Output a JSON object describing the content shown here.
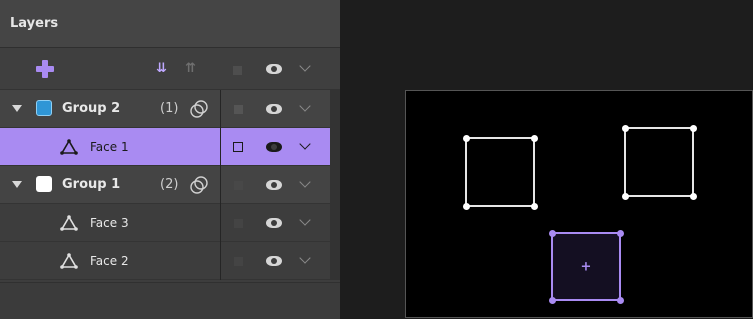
{
  "panel": {
    "title": "Layers",
    "toolbar": {
      "move_down_glyph": "⇊",
      "move_up_glyph": "⇈",
      "icons": [
        "add-layer-icon",
        "move-down-icon",
        "move-up-icon",
        "visibility-square-icon",
        "eye-icon",
        "chevron-down-icon"
      ]
    }
  },
  "layers": [
    {
      "label": "Group 2",
      "count": "(1)",
      "kind": "group",
      "swatch_color": "#2f96d6",
      "expanded": true,
      "visible": true,
      "selected": false
    },
    {
      "label": "Face 1",
      "kind": "face",
      "visible": true,
      "selected": true
    },
    {
      "label": "Group 1",
      "count": "(2)",
      "kind": "group",
      "swatch_color": "#ffffff",
      "expanded": true,
      "visible": true,
      "selected": false
    },
    {
      "label": "Face 3",
      "kind": "face",
      "visible": true,
      "selected": false
    },
    {
      "label": "Face 2",
      "kind": "face",
      "visible": true,
      "selected": false
    }
  ],
  "colors": {
    "accent_purple": "#a98bf2",
    "group2_accent": "#4ea3d6",
    "panel_bg": "#3d3d3d"
  },
  "viewport": {
    "center_marker": "+"
  }
}
